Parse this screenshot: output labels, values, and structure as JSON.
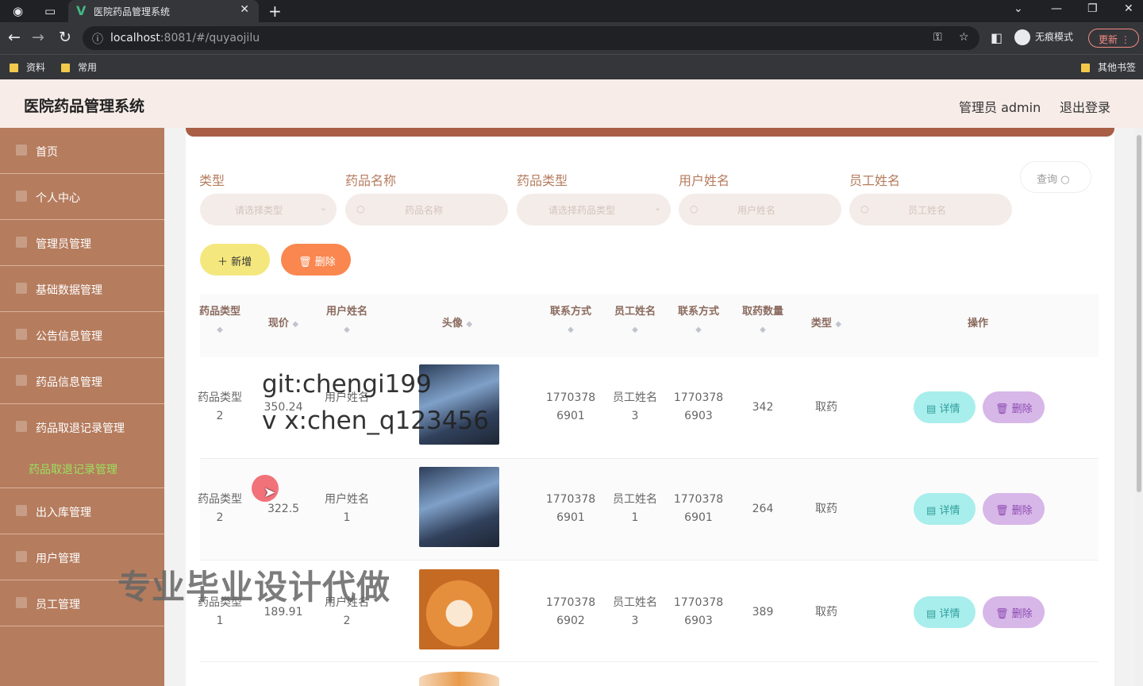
{
  "browser": {
    "tab_title": "医院药品管理系统",
    "url_host": "localhost",
    "url_path": ":8081/#/quyaojilu",
    "incognito_label": "无痕模式",
    "update_label": "更新",
    "bookmarks": [
      "资料",
      "常用"
    ],
    "other_bookmarks": "其他书签"
  },
  "header": {
    "title": "医院药品管理系统",
    "admin": "管理员 admin",
    "logout": "退出登录"
  },
  "sidebar": {
    "items": [
      {
        "label": "首页"
      },
      {
        "label": "个人中心"
      },
      {
        "label": "管理员管理"
      },
      {
        "label": "基础数据管理"
      },
      {
        "label": "公告信息管理"
      },
      {
        "label": "药品信息管理"
      },
      {
        "label": "药品取退记录管理"
      },
      {
        "label": "出入库管理"
      },
      {
        "label": "用户管理"
      },
      {
        "label": "员工管理"
      }
    ],
    "active_sub": "药品取退记录管理"
  },
  "filters": {
    "type_label": "类型",
    "type_placeholder": "请选择类型",
    "drug_name_label": "药品名称",
    "drug_name_placeholder": "药品名称",
    "drug_type_label": "药品类型",
    "drug_type_placeholder": "请选择药品类型",
    "user_name_label": "用户姓名",
    "user_name_placeholder": "用户姓名",
    "staff_name_label": "员工姓名",
    "staff_name_placeholder": "员工姓名",
    "query_label": "查询"
  },
  "actions": {
    "add_label": "新增",
    "delete_label": "删除"
  },
  "table": {
    "headers": {
      "drug_type": "药品类型",
      "price": "现价",
      "user_name": "用户姓名",
      "avatar": "头像",
      "user_phone": "联系方式",
      "staff_name": "员工姓名",
      "staff_phone": "联系方式",
      "qty": "取药数量",
      "type": "类型",
      "ops": "操作"
    },
    "rows": [
      {
        "drug_type_a": "药品类型",
        "drug_type_b": "2",
        "price": "350.24",
        "user_a": "用户姓名",
        "user_b": "",
        "user_phone_a": "1770378",
        "user_phone_b": "6901",
        "staff_a": "员工姓名",
        "staff_b": "3",
        "staff_phone_a": "1770378",
        "staff_phone_b": "6903",
        "qty": "342",
        "type": "取药",
        "avatar": "anime"
      },
      {
        "drug_type_a": "药品类型",
        "drug_type_b": "2",
        "price": "322.5",
        "user_a": "用户姓名",
        "user_b": "1",
        "user_phone_a": "1770378",
        "user_phone_b": "6901",
        "staff_a": "员工姓名",
        "staff_b": "1",
        "staff_phone_a": "1770378",
        "staff_phone_b": "6901",
        "qty": "264",
        "type": "取药",
        "avatar": "anime"
      },
      {
        "drug_type_a": "药品类型",
        "drug_type_b": "1",
        "price": "189.91",
        "user_a": "用户姓名",
        "user_b": "2",
        "user_phone_a": "1770378",
        "user_phone_b": "6902",
        "staff_a": "员工姓名",
        "staff_b": "3",
        "staff_phone_a": "1770378",
        "staff_phone_b": "6903",
        "qty": "389",
        "type": "取药",
        "avatar": "dog"
      }
    ],
    "detail_label": "详情",
    "row_delete_label": "删除"
  },
  "overlays": {
    "watermark_line1": "git:chengi199",
    "watermark_line2": "v x:chen_q123456",
    "watermark_ad": "专业毕业设计代做"
  }
}
